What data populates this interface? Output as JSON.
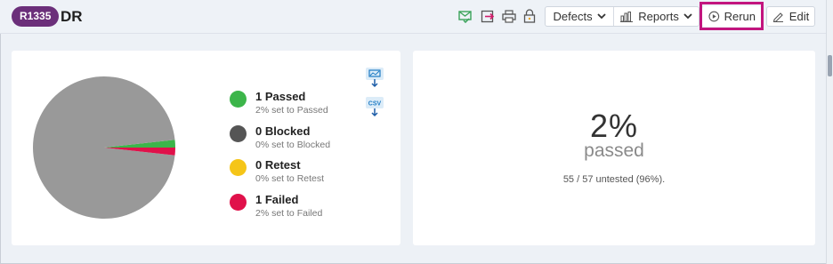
{
  "header": {
    "run_id": "R1335",
    "title": "DR"
  },
  "toolbar": {
    "defects_label": "Defects",
    "reports_label": "Reports",
    "rerun_label": "Rerun",
    "edit_label": "Edit"
  },
  "status_colors": {
    "passed": "#3cb54a",
    "blocked": "#555555",
    "retest": "#f5c518",
    "failed": "#e0114a",
    "untested": "#999999"
  },
  "chart_data": {
    "type": "pie",
    "slices": [
      {
        "name": "Passed",
        "value": 1,
        "color": "#3cb54a"
      },
      {
        "name": "Failed",
        "value": 1,
        "color": "#e0114a"
      },
      {
        "name": "Untested",
        "value": 55,
        "color": "#999999"
      }
    ]
  },
  "legend": [
    {
      "count_label": "1 Passed",
      "sub_label": "2% set to Passed"
    },
    {
      "count_label": "0 Blocked",
      "sub_label": "0% set to Blocked"
    },
    {
      "count_label": "0 Retest",
      "sub_label": "0% set to Retest"
    },
    {
      "count_label": "1 Failed",
      "sub_label": "2% set to Failed"
    }
  ],
  "downloads": {
    "csv_label": "CSV"
  },
  "summary": {
    "percent": "2%",
    "percent_label": "passed",
    "untested_text": "55 / 57 untested (96%)."
  }
}
